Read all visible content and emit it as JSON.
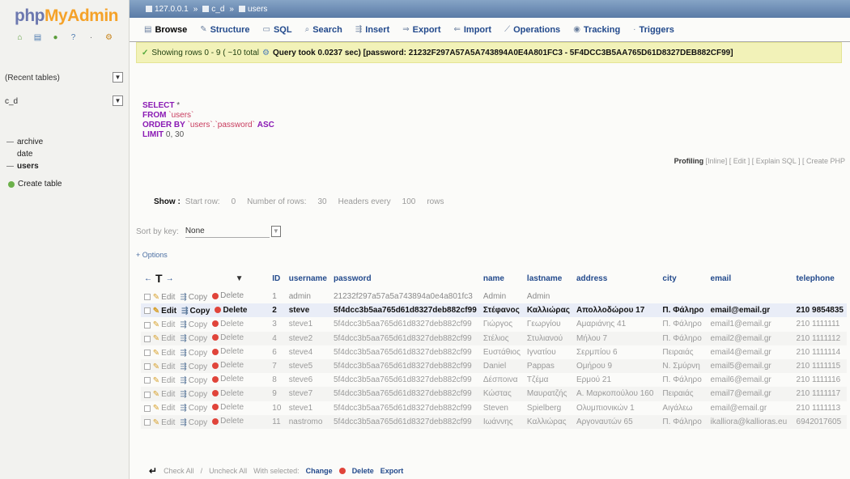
{
  "logo": {
    "php": "php",
    "myadmin": "MyAdmin"
  },
  "nav": {
    "recent_label": "(Recent tables)",
    "db_select": "c_d",
    "tables": [
      "archive",
      "date",
      "users"
    ],
    "create_table": "Create table"
  },
  "breadcrumb": [
    "127.0.0.1",
    "c_d",
    "users"
  ],
  "tabs": [
    {
      "label": "Browse",
      "icon": "browse-icon"
    },
    {
      "label": "Structure",
      "icon": "structure-icon"
    },
    {
      "label": "SQL",
      "icon": "sql-icon"
    },
    {
      "label": "Search",
      "icon": "search-icon"
    },
    {
      "label": "Insert",
      "icon": "insert-icon"
    },
    {
      "label": "Export",
      "icon": "export-icon"
    },
    {
      "label": "Import",
      "icon": "import-icon"
    },
    {
      "label": "Operations",
      "icon": "operations-icon"
    },
    {
      "label": "Tracking",
      "icon": "tracking-icon"
    },
    {
      "label": "Triggers",
      "icon": "triggers-icon"
    }
  ],
  "message": {
    "rows": "Showing rows 0 - 9 ( ~10 total",
    "query": "Query took 0.0237 sec) [password: 21232F297A57A5A743894A0E4A801FC3 - 5F4DCC3B5AA765D61D8327DEB882CF99]"
  },
  "sql": {
    "select": "SELECT",
    "select_rest": "*",
    "from": "FROM",
    "from_rest": "`users`",
    "order": "ORDER BY",
    "order_rest": "`users`.`password`",
    "asc": "ASC",
    "limit": "LIMIT",
    "limit_rest": "0, 30"
  },
  "profiling": {
    "label": "Profiling",
    "inline": "[Inline]",
    "edit": "[ Edit ]",
    "explain": "[ Explain SQL ]",
    "create": "[ Create PHP"
  },
  "show": {
    "label": "Show :",
    "start_row_label": "Start row:",
    "start_row": "0",
    "rows_label": "Number of rows:",
    "rows": "30",
    "headers_label": "Headers every",
    "headers": "100",
    "rows_unit": "rows"
  },
  "sort": {
    "label": "Sort by key:",
    "value": "None"
  },
  "options_label": "+ Options",
  "columns": [
    "ID",
    "username",
    "password",
    "name",
    "lastname",
    "address",
    "city",
    "email",
    "telephone"
  ],
  "row_actions": {
    "edit": "Edit",
    "copy": "Copy",
    "delete": "Delete"
  },
  "rows": [
    [
      "1",
      "admin",
      "21232f297a57a5a743894a0e4a801fc3",
      "Admin",
      "Admin",
      "",
      "",
      "",
      ""
    ],
    [
      "2",
      "steve",
      "5f4dcc3b5aa765d61d8327deb882cf99",
      "Στέφανος",
      "Καλλιώρας",
      "Απολλοδώρου 17",
      "Π. Φάληρο",
      "email@email.gr",
      "210 9854835"
    ],
    [
      "3",
      "steve1",
      "5f4dcc3b5aa765d61d8327deb882cf99",
      "Γιώργος",
      "Γεωργίου",
      "Αμαριάνης 41",
      "Π. Φάληρο",
      "email1@email.gr",
      "210 1111111"
    ],
    [
      "4",
      "steve2",
      "5f4dcc3b5aa765d61d8327deb882cf99",
      "Στέλιος",
      "Στυλιανού",
      "Μήλου 7",
      "Π. Φάληρο",
      "email2@email.gr",
      "210 1111112"
    ],
    [
      "6",
      "steve4",
      "5f4dcc3b5aa765d61d8327deb882cf99",
      "Ευστάθιος",
      "Ιγνατίου",
      "Σερμπίου 6",
      "Πειραιάς",
      "email4@email.gr",
      "210 1111114"
    ],
    [
      "7",
      "steve5",
      "5f4dcc3b5aa765d61d8327deb882cf99",
      "Daniel",
      "Pappas",
      "Ομήρου 9",
      "Ν. Σμύρνη",
      "email5@email.gr",
      "210 1111115"
    ],
    [
      "8",
      "steve6",
      "5f4dcc3b5aa765d61d8327deb882cf99",
      "Δέσποινα",
      "Τζέμα",
      "Ερμού 21",
      "Π. Φάληρο",
      "email6@email.gr",
      "210 1111116"
    ],
    [
      "9",
      "steve7",
      "5f4dcc3b5aa765d61d8327deb882cf99",
      "Κώστας",
      "Μαυρατζής",
      "Α. Μαρκοπούλου 160",
      "Πειραιάς",
      "email7@email.gr",
      "210 1111117"
    ],
    [
      "10",
      "steve1",
      "5f4dcc3b5aa765d61d8327deb882cf99",
      "Steven",
      "Spielberg",
      "Ολυμπιονικών 1",
      "Αιγάλεω",
      "email@email.gr",
      "210 1111113"
    ],
    [
      "11",
      "nastromo",
      "5f4dcc3b5aa765d61d8327deb882cf99",
      "Ιωάννης",
      "Καλλιώρας",
      "Αργοναυτών 65",
      "Π. Φάληρο",
      "ikalliora@kallioras.eu",
      "6942017605"
    ]
  ],
  "footer": {
    "check_all": "Check All",
    "uncheck_all": "Uncheck All",
    "with_selected": "With selected:",
    "change": "Change",
    "delete": "Delete",
    "export": "Export"
  },
  "colors": {
    "accent": "#234a8c",
    "success_bg": "#f2f2b8",
    "logo_php": "#6c78af",
    "logo_myadmin": "#f5a229"
  }
}
